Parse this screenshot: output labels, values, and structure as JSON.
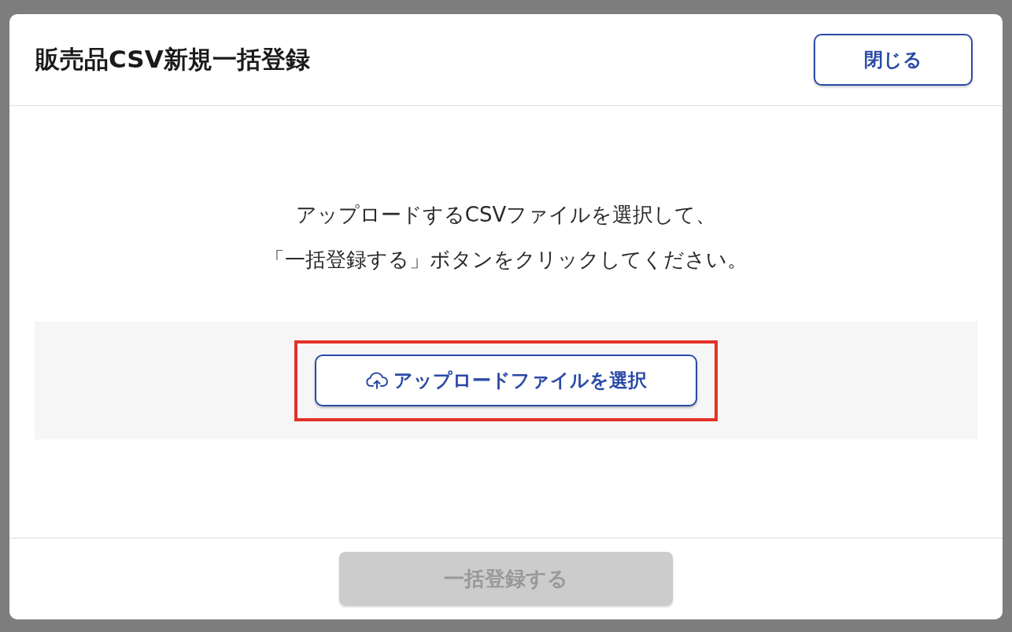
{
  "dialog": {
    "title": "販売品CSV新規一括登録",
    "close_button": "閉じる"
  },
  "instructions": [
    "アップロードするCSVファイルを選択して、",
    "「一括登録する」ボタンをクリックしてください。"
  ],
  "upload_button": {
    "label": "アップロードファイルを選択",
    "highlighted": true
  },
  "submit_button": {
    "label": "一括登録する",
    "disabled": true
  }
}
